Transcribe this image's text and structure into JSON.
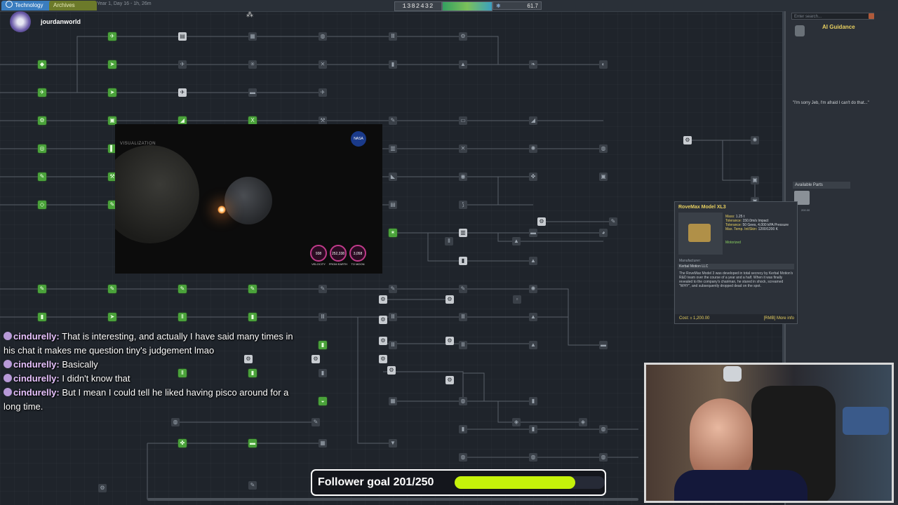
{
  "topbar": {
    "tab_technology": "Technology",
    "tab_archives": "Archives",
    "clock": "Year 1, Day 16 - 1h, 26m",
    "funds": "1382432",
    "reputation": "61.7"
  },
  "stream": {
    "username": "jourdanworld"
  },
  "visualization": {
    "title": "VISUALIZATION",
    "logo": "NASA",
    "gauges": [
      {
        "value": "938",
        "unit": "M/s",
        "label": "VELOCITY"
      },
      {
        "value": "252,338",
        "unit": "M/km",
        "label": "FROM EARTH"
      },
      {
        "value": "3,058",
        "unit": "M/km",
        "label": "TO MOON"
      }
    ]
  },
  "side_panel": {
    "search_placeholder": "Enter search...",
    "ai_guidance": "AI Guidance",
    "ai_quote": "\"I'm sorry Jeb, I'm afraid I can't do that...\"",
    "available_parts": "Available Parts",
    "part_cost": "200.00"
  },
  "part_card": {
    "title": "RoveMax Model XL3",
    "stats": [
      {
        "k": "Mass:",
        "v": "1.25 t"
      },
      {
        "k": "Tolerance:",
        "v": "150.0m/s Impact"
      },
      {
        "k": "Tolerance:",
        "v": "50 Gees, 4,000 kPA Pressure"
      },
      {
        "k": "Max. Temp. Int/Skin:",
        "v": "1200/1200 K"
      }
    ],
    "tag": "Motorized",
    "manufacturer_label": "Manufacturer:",
    "manufacturer": "Kerbal Motion LLC",
    "description": "The RoveMax Model 3 was developed in total secrecy by Kerbal Motion's R&D team over the course of a year and a half. When it was finally revealed to the company's chairman, he stared in shock, screamed \"WHY\", and subsequently dropped dead on the spot.",
    "cost": "Cost: ⬨ 1,200.00",
    "more_info": "[RMB] More info"
  },
  "chat": [
    {
      "user": "cindurelly:",
      "text": "That is interesting, and actually I have said many times in his chat it makes me question tiny's judgement lmao"
    },
    {
      "user": "cindurelly:",
      "text": "Basically"
    },
    {
      "user": "cindurelly:",
      "text": "I didn't know that"
    },
    {
      "user": "cindurelly:",
      "text": "But I mean I could tell he liked having pisco around for a long time."
    }
  ],
  "follower_goal": {
    "label": "Follower goal 201/250",
    "current": 201,
    "target": 250,
    "color": "#c5f20a"
  },
  "colors": {
    "unlocked_node": "#4aa23a",
    "locked_node": "#3a4048",
    "accent": "#e8d060"
  }
}
